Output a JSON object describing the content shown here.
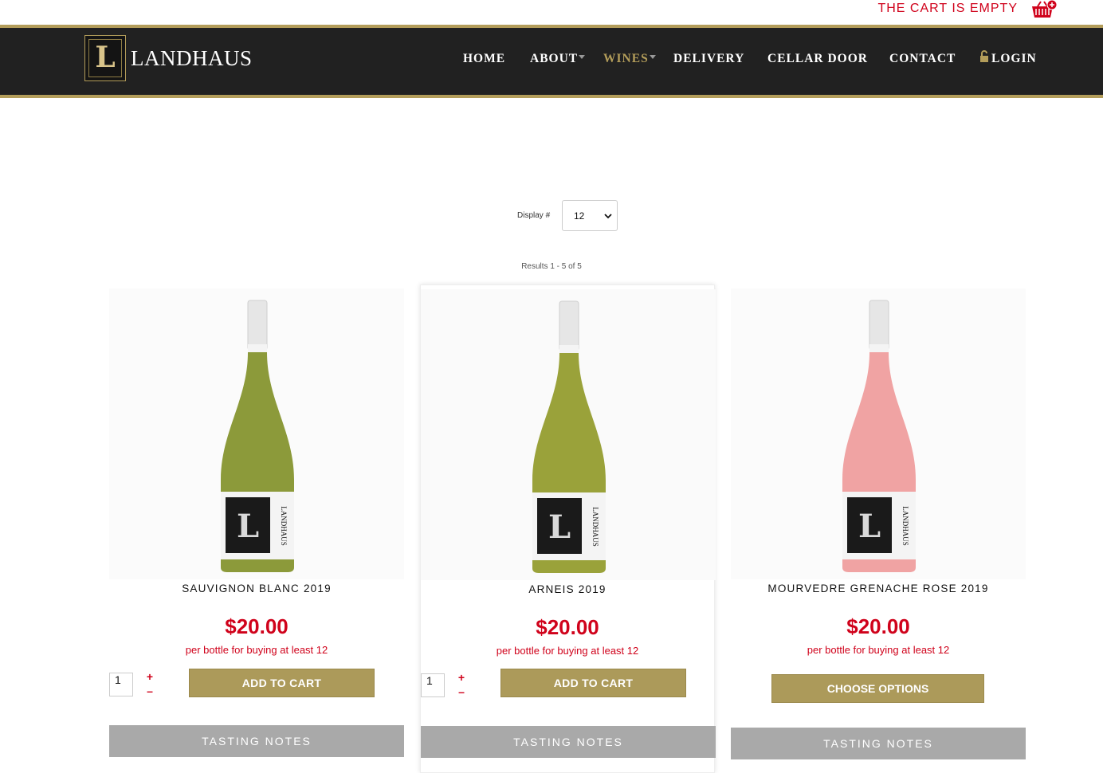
{
  "cart": {
    "status": "THE CART IS EMPTY"
  },
  "header": {
    "logo_text": "LANDHAUS",
    "logo_letter": "L",
    "nav": [
      {
        "label": "HOME",
        "active": false,
        "has_caret": false
      },
      {
        "label": "ABOUT",
        "active": false,
        "has_caret": true
      },
      {
        "label": "WINES",
        "active": true,
        "has_caret": true
      },
      {
        "label": "DELIVERY",
        "active": false,
        "has_caret": false
      },
      {
        "label": "CELLAR DOOR",
        "active": false,
        "has_caret": false
      },
      {
        "label": "CONTACT",
        "active": false,
        "has_caret": false
      },
      {
        "label": "LOGIN",
        "active": false,
        "has_caret": false
      }
    ]
  },
  "listing": {
    "display_label": "Display #",
    "display_value": "12",
    "results_text": "Results 1 - 5 of 5"
  },
  "products": [
    {
      "name": "SAUVIGNON BLANC 2019",
      "price": "$20.00",
      "price_note": "per bottle for buying at least 12",
      "qty": "1",
      "plus": "+",
      "minus": "–",
      "action": "ADD TO CART",
      "notes": "TASTING NOTES",
      "wine_color": "#8c9a3a"
    },
    {
      "name": "ARNEIS 2019",
      "price": "$20.00",
      "price_note": "per bottle for buying at least 12",
      "qty": "1",
      "plus": "+",
      "minus": "–",
      "action": "ADD TO CART",
      "notes": "TASTING NOTES",
      "wine_color": "#9aa23a"
    },
    {
      "name": "MOURVEDRE GRENACHE ROSE 2019",
      "price": "$20.00",
      "price_note": "per bottle for buying at least 12",
      "action": "CHOOSE OPTIONS",
      "notes": "TASTING NOTES",
      "wine_color": "#f0a3a3"
    }
  ],
  "colors": {
    "brand_gold": "#b39d5a",
    "price_red": "#d0021b",
    "header_bg": "#212121"
  }
}
